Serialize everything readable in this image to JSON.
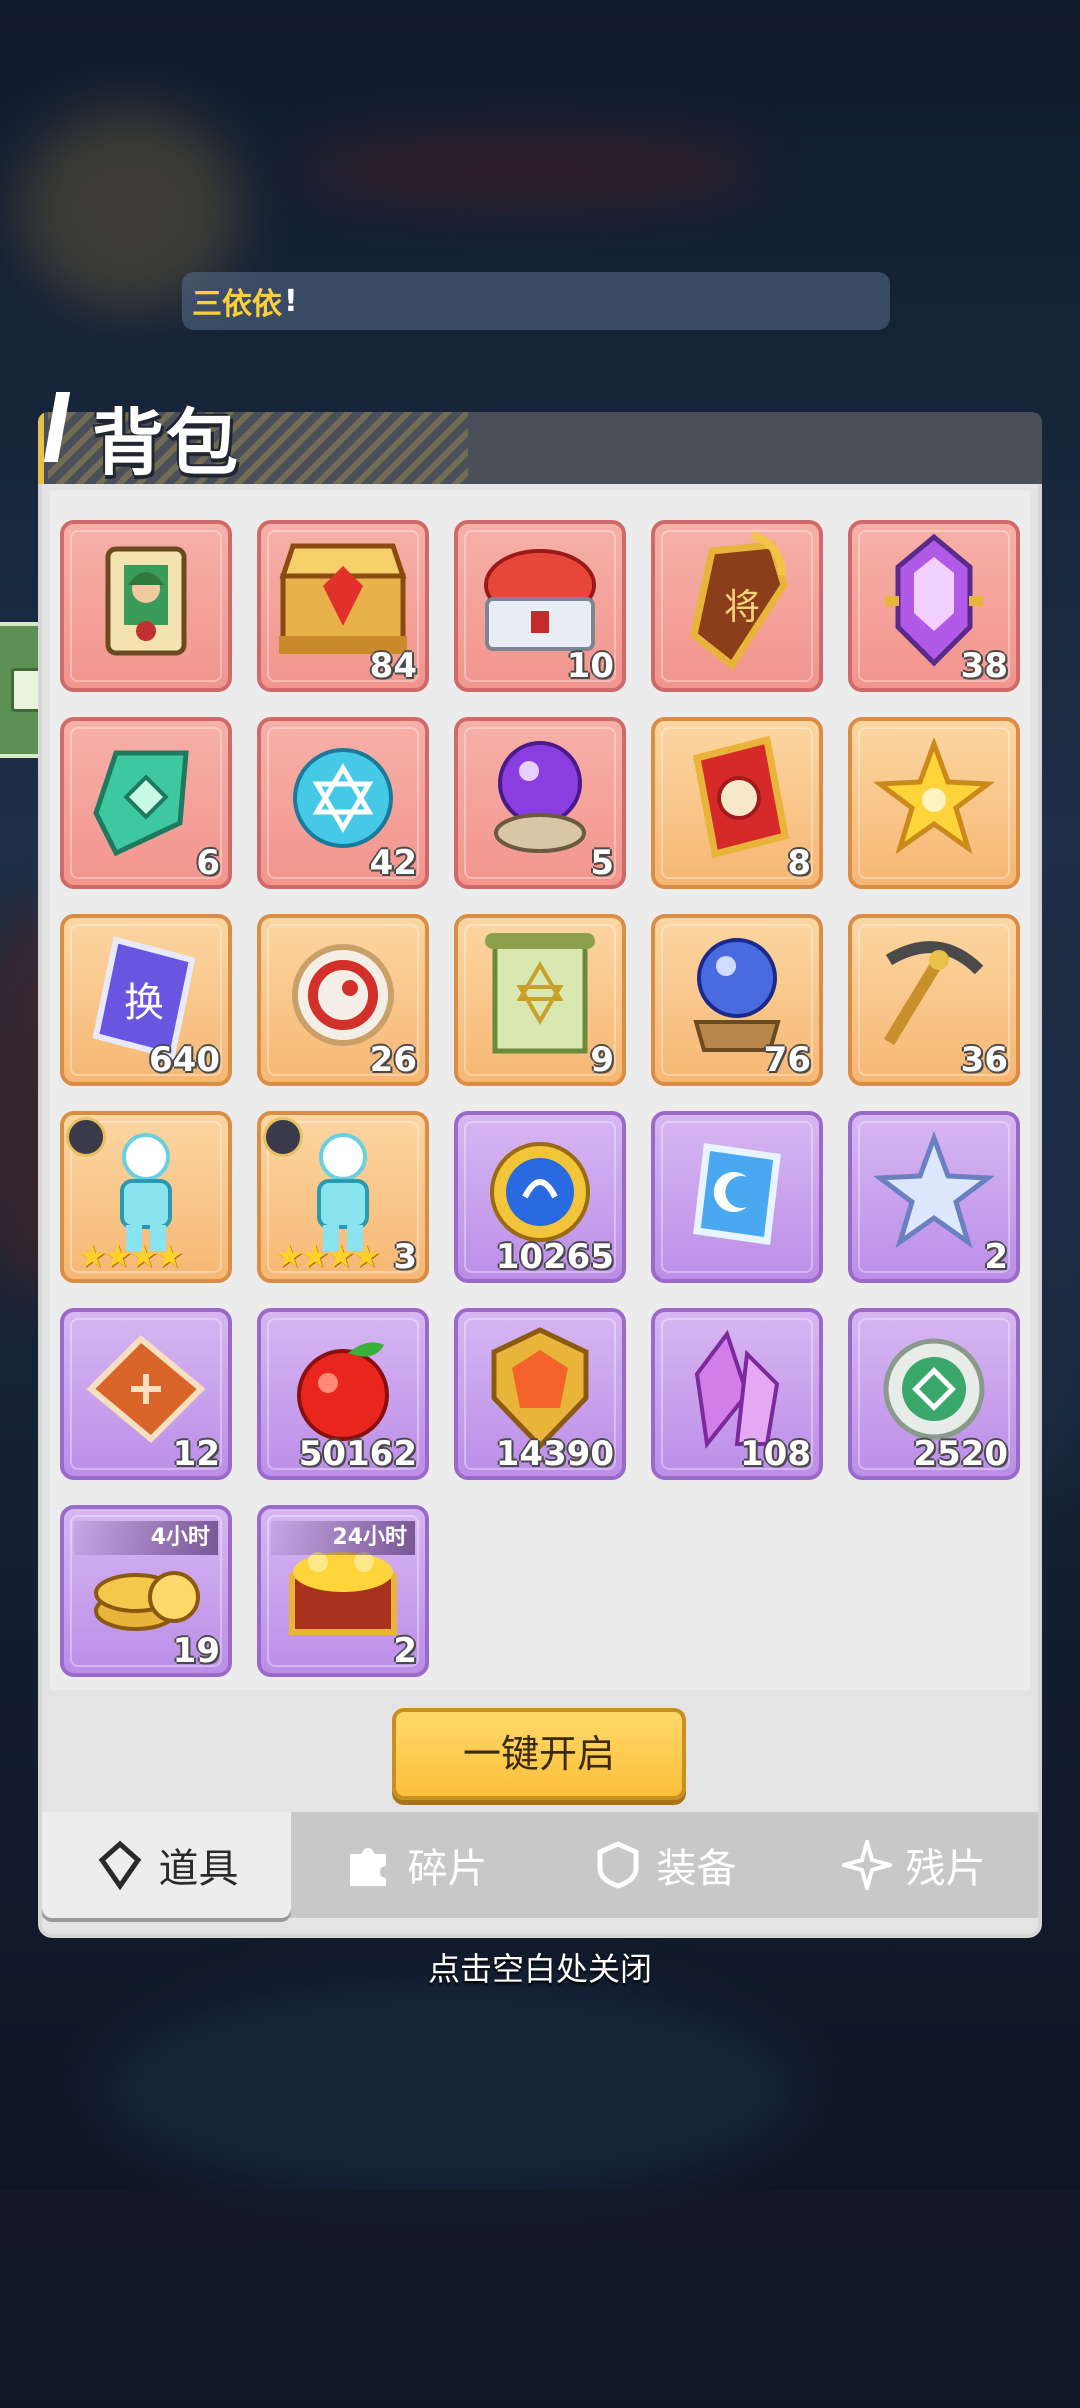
{
  "chat": {
    "name": "三依依",
    "excl": "!"
  },
  "panel": {
    "title": "背包"
  },
  "items": [
    {
      "id": "hero-card",
      "color": "red",
      "icon": "hero-card-icon",
      "count": ""
    },
    {
      "id": "red-chest",
      "color": "red",
      "icon": "ornate-chest-icon",
      "count": "84"
    },
    {
      "id": "silver-chest",
      "color": "red",
      "icon": "silver-chest-icon",
      "count": "10"
    },
    {
      "id": "general-token",
      "color": "red",
      "icon": "general-token-icon",
      "count": ""
    },
    {
      "id": "purple-crystal",
      "color": "red",
      "icon": "purple-crystal-icon",
      "count": "38"
    },
    {
      "id": "green-token",
      "color": "red",
      "icon": "green-token-icon",
      "count": "6"
    },
    {
      "id": "blue-orb",
      "color": "red",
      "icon": "hexagram-orb-icon",
      "count": "42"
    },
    {
      "id": "purple-orb",
      "color": "red",
      "icon": "purple-orb-icon",
      "count": "5"
    },
    {
      "id": "red-talisman",
      "color": "orange",
      "icon": "red-talisman-icon",
      "count": "8"
    },
    {
      "id": "gold-star",
      "color": "orange",
      "icon": "gold-star-icon",
      "count": ""
    },
    {
      "id": "exchange-ticket",
      "color": "orange",
      "icon": "exchange-ticket-icon",
      "count": "640"
    },
    {
      "id": "dragon-coin",
      "color": "orange",
      "icon": "dragon-coin-icon",
      "count": "26"
    },
    {
      "id": "scroll",
      "color": "orange",
      "icon": "scroll-icon",
      "count": "9"
    },
    {
      "id": "blue-orb-stand",
      "color": "orange",
      "icon": "blue-orb-icon",
      "count": "76"
    },
    {
      "id": "pickaxe",
      "color": "orange",
      "icon": "pickaxe-icon",
      "count": "36"
    },
    {
      "id": "figure-a",
      "color": "orange",
      "icon": "figure-icon",
      "count": "",
      "stars": "★★★★"
    },
    {
      "id": "figure-b",
      "color": "orange",
      "icon": "figure-icon",
      "count": "3",
      "stars": "★★★★"
    },
    {
      "id": "blue-coin",
      "color": "purple",
      "icon": "blue-coin-icon",
      "count": "10265"
    },
    {
      "id": "moon-badge",
      "color": "purple",
      "icon": "moon-badge-icon",
      "count": ""
    },
    {
      "id": "silver-star",
      "color": "purple",
      "icon": "silver-star-icon",
      "count": "2"
    },
    {
      "id": "red-ticket",
      "color": "purple",
      "icon": "red-ticket-icon",
      "count": "12"
    },
    {
      "id": "apple",
      "color": "purple",
      "icon": "apple-icon",
      "count": "50162"
    },
    {
      "id": "gem-shield",
      "color": "purple",
      "icon": "gem-shield-icon",
      "count": "14390"
    },
    {
      "id": "crystal",
      "color": "purple",
      "icon": "crystal-icon",
      "count": "108"
    },
    {
      "id": "green-coin",
      "color": "purple",
      "icon": "green-coin-icon",
      "count": "2520"
    },
    {
      "id": "gold-coins",
      "color": "purple",
      "icon": "gold-coins-icon",
      "count": "19",
      "timer": "4小时"
    },
    {
      "id": "treasure-chest",
      "color": "purple",
      "icon": "treasure-chest-icon",
      "count": "2",
      "timer": "24小时"
    }
  ],
  "open_all_label": "一键开启",
  "tabs": [
    {
      "id": "props",
      "label": "道具",
      "icon": "props-icon",
      "active": true
    },
    {
      "id": "fragments",
      "label": "碎片",
      "icon": "puzzle-icon",
      "active": false
    },
    {
      "id": "equipment",
      "label": "装备",
      "icon": "armor-icon",
      "active": false
    },
    {
      "id": "remnants",
      "label": "残片",
      "icon": "shard-icon",
      "active": false
    }
  ],
  "close_hint": "点击空白处关闭",
  "colors": {
    "accent": "#fbbf3a",
    "red_cell": "#f2958d",
    "orange_cell": "#f6b774",
    "purple_cell": "#bc8ee8"
  }
}
